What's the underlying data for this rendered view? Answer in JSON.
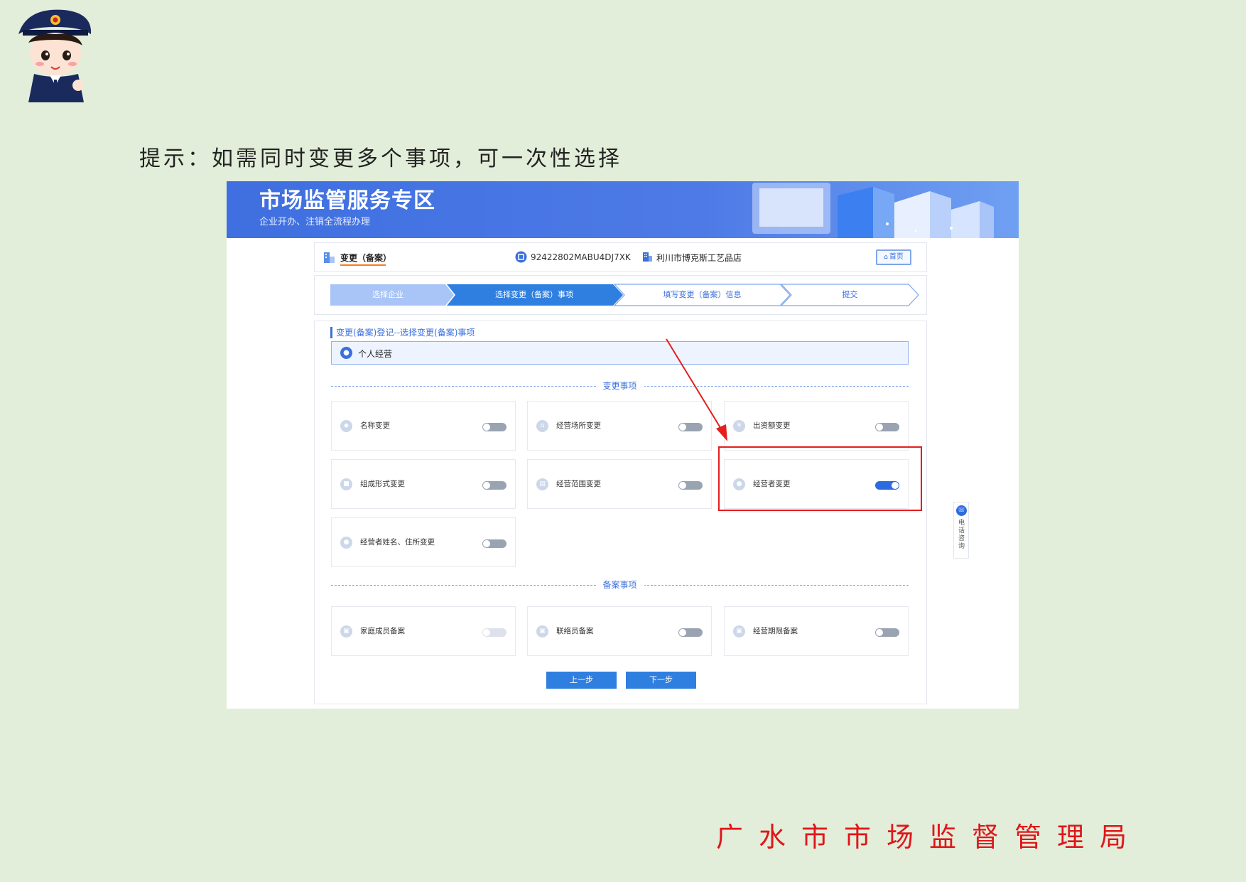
{
  "hint": "提示：如需同时变更多个事项，可一次性选择",
  "footer_org": "广水市市场监督管理局",
  "banner": {
    "title": "市场监管服务专区",
    "subtitle": "企业开办、注销全流程办理"
  },
  "topbar": {
    "title": "变更（备案）",
    "credit_code": "92422802MABU4DJ7XK",
    "company": "利川市博克斯工艺品店",
    "home_label": "首页"
  },
  "steps": [
    {
      "label": "选择企业",
      "state": "done"
    },
    {
      "label": "选择变更（备案）事项",
      "state": "active"
    },
    {
      "label": "填写变更（备案）信息",
      "state": "todo"
    },
    {
      "label": "提交",
      "state": "todo"
    }
  ],
  "section_title": "变更(备案)登记--选择变更(备案)事项",
  "business_type": "个人经营",
  "change_header": "变更事项",
  "change_items": [
    {
      "label": "名称变更",
      "on": false
    },
    {
      "label": "经营场所变更",
      "on": false
    },
    {
      "label": "出资额变更",
      "on": false
    },
    {
      "label": "组成形式变更",
      "on": false
    },
    {
      "label": "经营范围变更",
      "on": false
    },
    {
      "label": "经营者变更",
      "on": true
    },
    {
      "label": "经营者姓名、住所变更",
      "on": false
    }
  ],
  "filing_header": "备案事项",
  "filing_items": [
    {
      "label": "家庭成员备案",
      "on": false,
      "disabled": true
    },
    {
      "label": "联络员备案",
      "on": false
    },
    {
      "label": "经营期限备案",
      "on": false
    }
  ],
  "buttons": {
    "prev": "上一步",
    "next": "下一步"
  },
  "phone_consult": "电话咨询",
  "colors": {
    "primary": "#3a6fde",
    "toggle_on": "#2d6ae0",
    "highlight": "#e51e1e",
    "footer_text": "#e0161b",
    "page_bg": "#e2eed9"
  }
}
